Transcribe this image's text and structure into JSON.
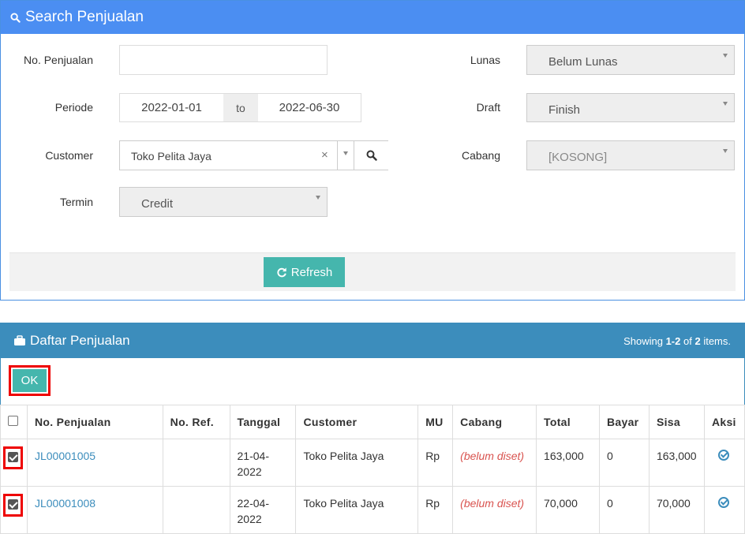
{
  "search": {
    "title": "Search Penjualan",
    "labels": {
      "no_penjualan": "No. Penjualan",
      "periode": "Periode",
      "customer": "Customer",
      "termin": "Termin",
      "lunas": "Lunas",
      "draft": "Draft",
      "cabang": "Cabang"
    },
    "no_penjualan_value": "",
    "date_from": "2022-01-01",
    "date_sep": "to",
    "date_to": "2022-06-30",
    "customer_value": "Toko Pelita Jaya",
    "customer_clear": "×",
    "termin_value": "Credit",
    "lunas_value": "Belum Lunas",
    "draft_value": "Finish",
    "cabang_value": "[KOSONG]",
    "refresh_label": "Refresh"
  },
  "list": {
    "title": "Daftar Penjualan",
    "summary_prefix": "Showing",
    "summary_range": "1-2",
    "summary_mid": "of",
    "summary_total": "2",
    "summary_suffix": "items.",
    "ok_label": "OK",
    "columns": [
      "No. Penjualan",
      "No. Ref.",
      "Tanggal",
      "Customer",
      "MU",
      "Cabang",
      "Total",
      "Bayar",
      "Sisa",
      "Aksi"
    ],
    "rows": [
      {
        "no": "JL00001005",
        "ref": "",
        "tanggal": "21-04-2022",
        "customer": "Toko Pelita Jaya",
        "mu": "Rp",
        "cabang": "(belum diset)",
        "total": "163,000",
        "bayar": "0",
        "sisa": "163,000"
      },
      {
        "no": "JL00001008",
        "ref": "",
        "tanggal": "22-04-2022",
        "customer": "Toko Pelita Jaya",
        "mu": "Rp",
        "cabang": "(belum diset)",
        "total": "70,000",
        "bayar": "0",
        "sisa": "70,000"
      }
    ]
  },
  "colors": {
    "search_header": "#4b8ef2",
    "list_header": "#3c8dbc",
    "button": "#45b6ad",
    "highlight": "#ee0000"
  }
}
